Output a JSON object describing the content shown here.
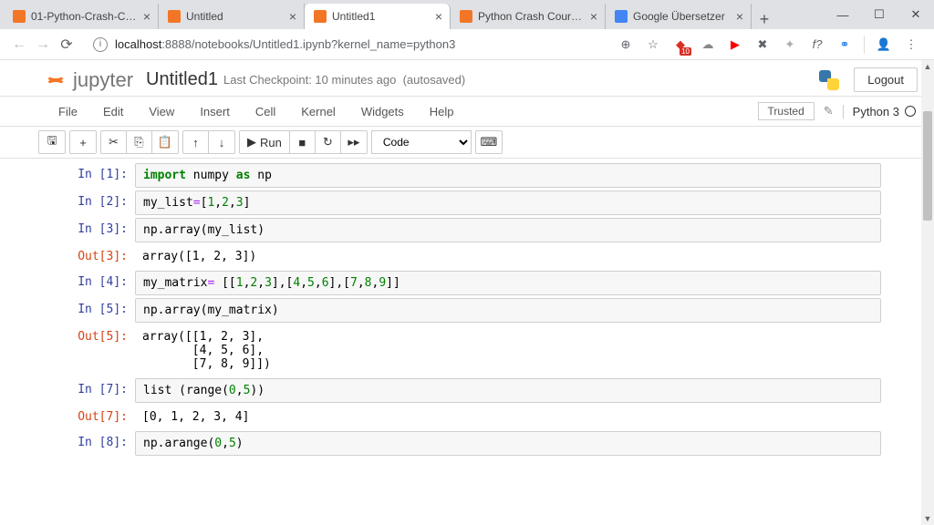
{
  "browser": {
    "tabs": [
      {
        "title": "01-Python-Crash-Course/",
        "favicon": "#f37626"
      },
      {
        "title": "Untitled",
        "favicon": "#f37626"
      },
      {
        "title": "Untitled1",
        "favicon": "#f37626",
        "active": true
      },
      {
        "title": "Python Crash Course Exerc",
        "favicon": "#f37626"
      },
      {
        "title": "Google Übersetzer",
        "favicon": "#4285f4"
      }
    ],
    "url_prefix": "localhost",
    "url_rest": ":8888/notebooks/Untitled1.ipynb?kernel_name=python3"
  },
  "jupyter": {
    "logo_text": "jupyter",
    "title": "Untitled1",
    "checkpoint": "Last Checkpoint: 10 minutes ago",
    "autosave": "(autosaved)",
    "logout": "Logout",
    "menu": [
      "File",
      "Edit",
      "View",
      "Insert",
      "Cell",
      "Kernel",
      "Widgets",
      "Help"
    ],
    "trusted": "Trusted",
    "kernel": "Python 3",
    "toolbar": {
      "run": "Run",
      "celltype": "Code"
    }
  },
  "cells": [
    {
      "in": "In [1]:",
      "code_html": "<span class='kw'>import</span> numpy <span class='as'>as</span> np"
    },
    {
      "in": "In [2]:",
      "code_html": "my_list<span class='op'>=</span>[<span class='num'>1</span>,<span class='num'>2</span>,<span class='num'>3</span>]"
    },
    {
      "in": "In [3]:",
      "code_html": "np.array(my_list)",
      "out": "Out[3]:",
      "output": "array([1, 2, 3])"
    },
    {
      "in": "In [4]:",
      "code_html": "my_matrix<span class='op'>=</span> [[<span class='num'>1</span>,<span class='num'>2</span>,<span class='num'>3</span>],[<span class='num'>4</span>,<span class='num'>5</span>,<span class='num'>6</span>],[<span class='num'>7</span>,<span class='num'>8</span>,<span class='num'>9</span>]]"
    },
    {
      "in": "In [5]:",
      "code_html": "np.array(my_matrix)",
      "out": "Out[5]:",
      "output": "array([[1, 2, 3],\n       [4, 5, 6],\n       [7, 8, 9]])"
    },
    {
      "in": "In [7]:",
      "code_html": "list (range(<span class='num'>0</span>,<span class='num'>5</span>))",
      "out": "Out[7]:",
      "output": "[0, 1, 2, 3, 4]"
    },
    {
      "in": "In [8]:",
      "code_html": "np.arange(<span class='num'>0</span>,<span class='num'>5</span>)"
    }
  ]
}
